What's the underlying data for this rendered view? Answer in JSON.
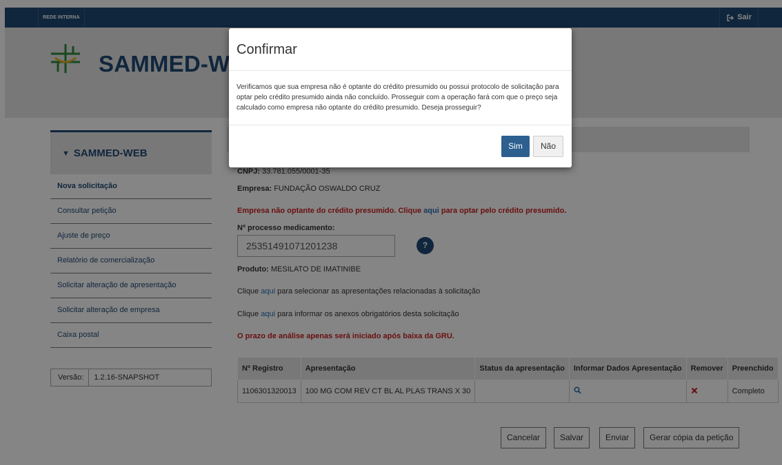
{
  "topbar": {
    "intranet_label": "REDE INTERNA",
    "logout_label": "Sair"
  },
  "header": {
    "app_name": "SAMMED-WEB"
  },
  "sidebar": {
    "title": "SAMMED-WEB",
    "items": [
      {
        "label": "Nova solicitação",
        "active": true
      },
      {
        "label": "Consultar petição"
      },
      {
        "label": "Ajuste de preço"
      },
      {
        "label": "Relatório de comercialização"
      },
      {
        "label": "Solicitar alteração de apresentação"
      },
      {
        "label": "Solicitar alteração de empresa"
      },
      {
        "label": "Caixa postal"
      }
    ],
    "version_label": "Versão:",
    "version_value": "1.2.16-SNAPSHOT"
  },
  "form": {
    "cnpj_label": "CNPJ:",
    "cnpj_value": "33.781.055/0001-35",
    "company_label": "Empresa:",
    "company_value": "FUNDAÇÃO OSWALDO CRUZ",
    "warning_prefix": "Empresa não optante do crédito presumido. Clique ",
    "warning_link": "aqui",
    "warning_suffix": " para optar pelo crédito presumido.",
    "process_label": "Nº processo medicamento:",
    "process_value": "25351491071201238",
    "help_label": "?",
    "product_label": "Produto:",
    "product_value": "MESILATO DE IMATINIBE",
    "click_prefix": "Clique ",
    "click_link": "aqui",
    "presentations_suffix": " para selecionar as apresentações relacionadas à solicitação",
    "attachments_suffix": " para informar os anexos obrigatórios desta solicitação",
    "gru_notice": "O prazo de análise apenas será iniciado após baixa da GRU."
  },
  "table": {
    "headers": [
      "Nº Registro",
      "Apresentação",
      "Status da apresentação",
      "Informar Dados Apresentação",
      "Remover",
      "Preenchido"
    ],
    "rows": [
      {
        "registro": "1106301320013",
        "apresentacao": "100 MG COM REV CT BL AL PLAS TRANS X 30",
        "status": "",
        "preenchido": "Completo"
      }
    ]
  },
  "actions": {
    "cancel": "Cancelar",
    "save": "Salvar",
    "send": "Enviar",
    "copy": "Gerar cópia da petição"
  },
  "modal": {
    "title": "Confirmar",
    "message": "Verificamos que sua empresa não é optante do crédito presumido ou possui protocolo de solicitação para optar pelo crédito presumido ainda não concluído. Prosseguir com a operação fará com que o preço seja calculado como empresa não optante do crédito presumido. Deseja prosseguir?",
    "yes": "Sim",
    "no": "Não"
  },
  "colors": {
    "primary": "#1f4a75",
    "accent_button": "#2d5f8f",
    "warning": "#cc1f1f",
    "link": "#2a6fb0"
  }
}
